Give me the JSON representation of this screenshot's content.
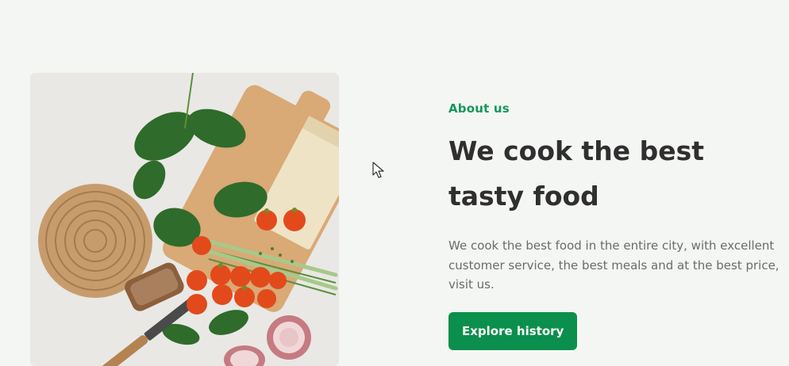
{
  "about": {
    "subtitle": "About us",
    "title": "We cook the best tasty food",
    "description": "We cook the best food in the entire city, with excellent customer service, the best meals and at the best price, visit us.",
    "button_label": "Explore history"
  },
  "image": {
    "subject": "food-ingredients-photo"
  },
  "colors": {
    "background": "#f4f6f3",
    "accent": "#14975a",
    "button": "#0b8f4c",
    "title": "#2f2f2f",
    "text": "#6b6b6b"
  }
}
